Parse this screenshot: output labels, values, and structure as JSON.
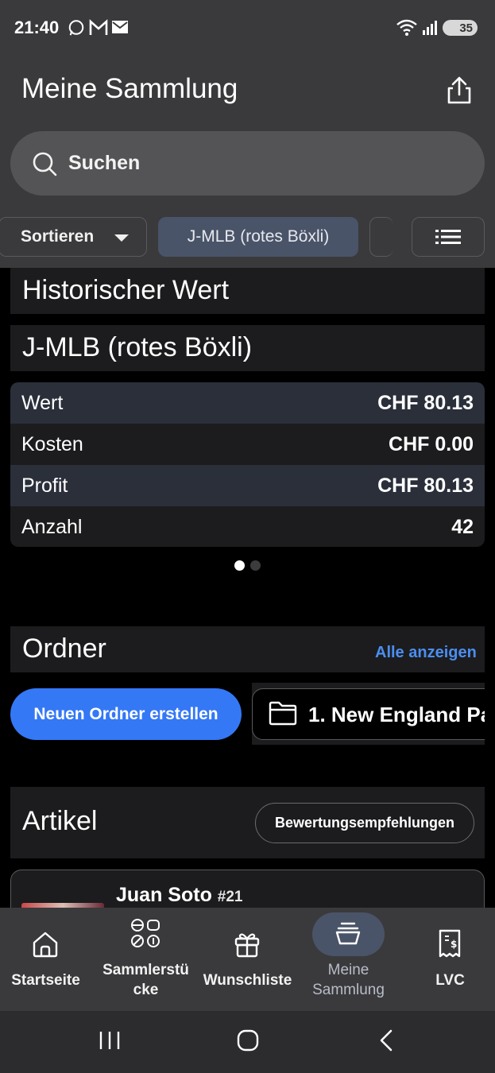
{
  "status_bar": {
    "time": "21:40",
    "battery": "35"
  },
  "header": {
    "title": "Meine Sammlung",
    "search_placeholder": "Suchen",
    "sort_label": "Sortieren",
    "collection_chip": "J-MLB (rotes Böxli)"
  },
  "historical": {
    "section_title": "Historischer Wert",
    "collection_name": "J-MLB (rotes Böxli)",
    "rows": [
      {
        "label": "Wert",
        "value": "CHF 80.13"
      },
      {
        "label": "Kosten",
        "value": "CHF 0.00"
      },
      {
        "label": "Profit",
        "value": "CHF 80.13"
      },
      {
        "label": "Anzahl",
        "value": "42"
      }
    ]
  },
  "folders": {
    "title": "Ordner",
    "show_all": "Alle anzeigen",
    "new_folder": "Neuen Ordner erstellen",
    "items": [
      {
        "name": "1. New England Pa"
      }
    ]
  },
  "articles": {
    "title": "Artikel",
    "recommend_button": "Bewertungsempfehlungen",
    "items": [
      {
        "name": "Juan Soto",
        "number": "#21"
      }
    ]
  },
  "bottom_nav": [
    {
      "label": "Startseite",
      "icon": "home-icon"
    },
    {
      "label": "Sammlerstü cke",
      "icon": "collectibles-icon"
    },
    {
      "label": "Wunschliste",
      "icon": "gift-icon"
    },
    {
      "label": "Meine Sammlung",
      "icon": "basket-icon",
      "active": true
    },
    {
      "label": "LVC",
      "icon": "receipt-icon"
    }
  ],
  "colors": {
    "accent": "#3478f6",
    "link": "#4b8ef0",
    "chip_active": "#4a5468",
    "header_bg": "#3a3a3c",
    "panel_bg": "#1c1c1e"
  }
}
